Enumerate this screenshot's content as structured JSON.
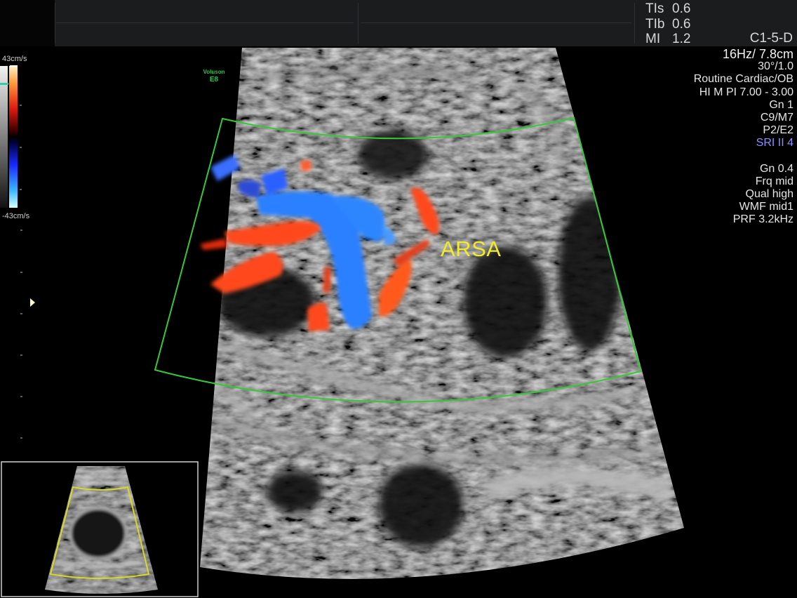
{
  "header": {
    "safety": [
      {
        "label": "TIs",
        "value": "0.6"
      },
      {
        "label": "TIb",
        "value": "0.6"
      },
      {
        "label": "MI",
        "value": "1.2"
      }
    ],
    "probe": "C1-5-D"
  },
  "params": {
    "frame": "16Hz/ 7.8cm",
    "angle": "30°/1.0",
    "preset": "Routine Cardiac/OB",
    "harmonic": "HI M PI 7.00 - 3.00",
    "gain": "Gn   1",
    "map": "C9/M7",
    "persistence": "P2/E2",
    "sri": "SRI II 4",
    "cf_gain": "Gn  0.4",
    "frq": "Frq mid",
    "qual": "Qual high",
    "wmf": "WMF mid1",
    "prf": "PRF  3.2kHz"
  },
  "colorbar": {
    "top_label": "43cm/s",
    "bottom_label": "-43cm/s"
  },
  "brand": {
    "name": "Voluson",
    "model": "E8"
  },
  "annotation": {
    "text": "ARSA"
  },
  "colors": {
    "roi_box": "#35c935",
    "thumb_roi": "#d8d82a",
    "flow_toward": "#ff4a1a",
    "flow_away": "#2a78ff",
    "annotation": "#f2ea2a",
    "sri": "#8f8fff"
  }
}
